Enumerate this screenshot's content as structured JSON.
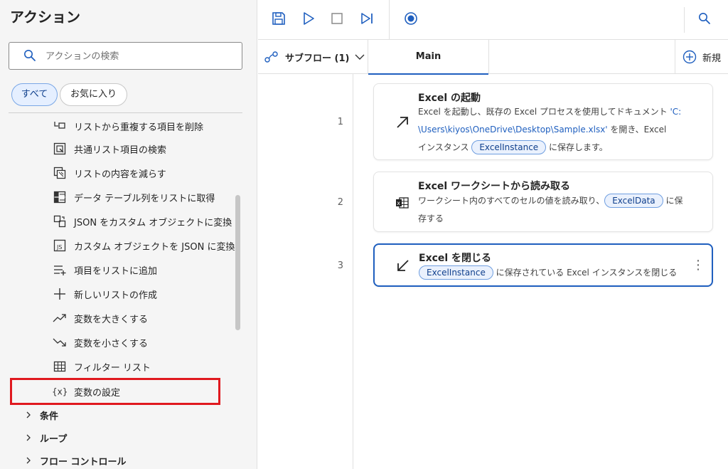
{
  "left": {
    "title": "アクション",
    "search_placeholder": "アクションの検索",
    "filters": {
      "all": "すべて",
      "favorites": "お気に入り"
    },
    "actions": [
      {
        "label": "リストから重複する項目を削除",
        "icon": "dedupe-list-icon"
      },
      {
        "label": "共通リスト項目の検索",
        "icon": "find-common-icon"
      },
      {
        "label": "リストの内容を減らす",
        "icon": "subtract-list-icon"
      },
      {
        "label": "データ テーブル列をリストに取得",
        "icon": "table-column-icon"
      },
      {
        "label": "JSON をカスタム オブジェクトに変換",
        "icon": "json-convert-icon"
      },
      {
        "label": "カスタム オブジェクトを JSON に変換",
        "icon": "js-file-icon"
      },
      {
        "label": "項目をリストに追加",
        "icon": "list-add-icon"
      },
      {
        "label": "新しいリストの作成",
        "icon": "plus-icon"
      },
      {
        "label": "変数を大きくする",
        "icon": "trend-up-icon"
      },
      {
        "label": "変数を小さくする",
        "icon": "trend-down-icon"
      },
      {
        "label": "フィルター リスト",
        "icon": "grid-icon"
      },
      {
        "label": "変数の設定",
        "icon": "variable-icon"
      }
    ],
    "categories": [
      {
        "label": "条件"
      },
      {
        "label": "ループ"
      },
      {
        "label": "フロー コントロール"
      }
    ]
  },
  "tabs": {
    "subflow": "サブフロー (1)",
    "main": "Main",
    "new": "新規"
  },
  "steps": [
    {
      "number": "1",
      "title": "Excel の起動",
      "desc_1": "Excel を起動し、既存の Excel プロセスを使用してドキュメント ",
      "desc_link_1": "'C:",
      "desc_link_2": "\\Users\\kiyos\\OneDrive\\Desktop\\Sample.xlsx'",
      "desc_2": " を開き、Excel",
      "desc_3": "インスタンス ",
      "var": "ExcelInstance",
      "desc_4": " に保存します。",
      "icon": "arrow-up-right-icon"
    },
    {
      "number": "2",
      "title": "Excel ワークシートから読み取る",
      "desc_1": "ワークシート内のすべてのセルの値を読み取り、",
      "var": "ExcelData",
      "desc_2": " に保",
      "desc_3": "存する",
      "icon": "excel-read-icon"
    },
    {
      "number": "3",
      "title": "Excel を閉じる",
      "var": "ExcelInstance",
      "desc_1": " に保存されている Excel インスタンスを閉じる",
      "icon": "arrow-down-left-icon"
    }
  ],
  "colors": {
    "accent": "#1f5fbf",
    "highlight": "#e0191f"
  }
}
